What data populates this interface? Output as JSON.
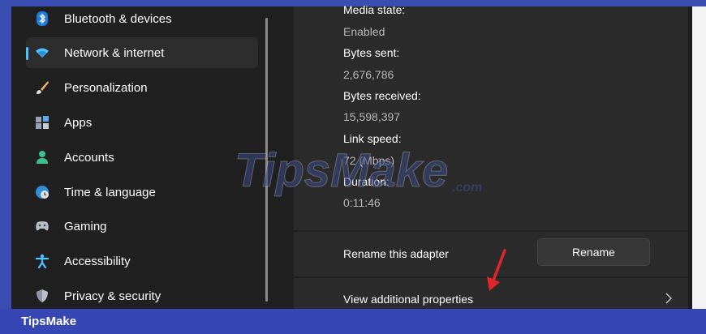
{
  "sidebar": {
    "items": [
      {
        "label": "Bluetooth & devices",
        "icon": "bluetooth-icon"
      },
      {
        "label": "Network & internet",
        "icon": "wifi-icon",
        "active": true
      },
      {
        "label": "Personalization",
        "icon": "brush-icon"
      },
      {
        "label": "Apps",
        "icon": "apps-icon"
      },
      {
        "label": "Accounts",
        "icon": "person-icon"
      },
      {
        "label": "Time & language",
        "icon": "globe-clock-icon"
      },
      {
        "label": "Gaming",
        "icon": "gamepad-icon"
      },
      {
        "label": "Accessibility",
        "icon": "accessibility-icon"
      },
      {
        "label": "Privacy & security",
        "icon": "shield-icon"
      }
    ]
  },
  "details": {
    "media_state_label": "Media state:",
    "media_state_value": "Enabled",
    "bytes_sent_label": "Bytes sent:",
    "bytes_sent_value": "2,676,786",
    "bytes_received_label": "Bytes received:",
    "bytes_received_value": "15,598,397",
    "link_speed_label": "Link speed:",
    "link_speed_value": "72 (Mbps)",
    "duration_label": "Duration:",
    "duration_value": "0:11:46"
  },
  "rename_row": {
    "label": "Rename this adapter",
    "button": "Rename"
  },
  "properties_row": {
    "label": "View additional properties"
  },
  "watermark": {
    "brand": "TipsMake",
    "suffix": ".com"
  },
  "footer": {
    "brand": "TipsMake"
  },
  "colors": {
    "accent": "#4cc2ff",
    "frame_blue": "#3647b5",
    "arrow_red": "#e0262b"
  }
}
